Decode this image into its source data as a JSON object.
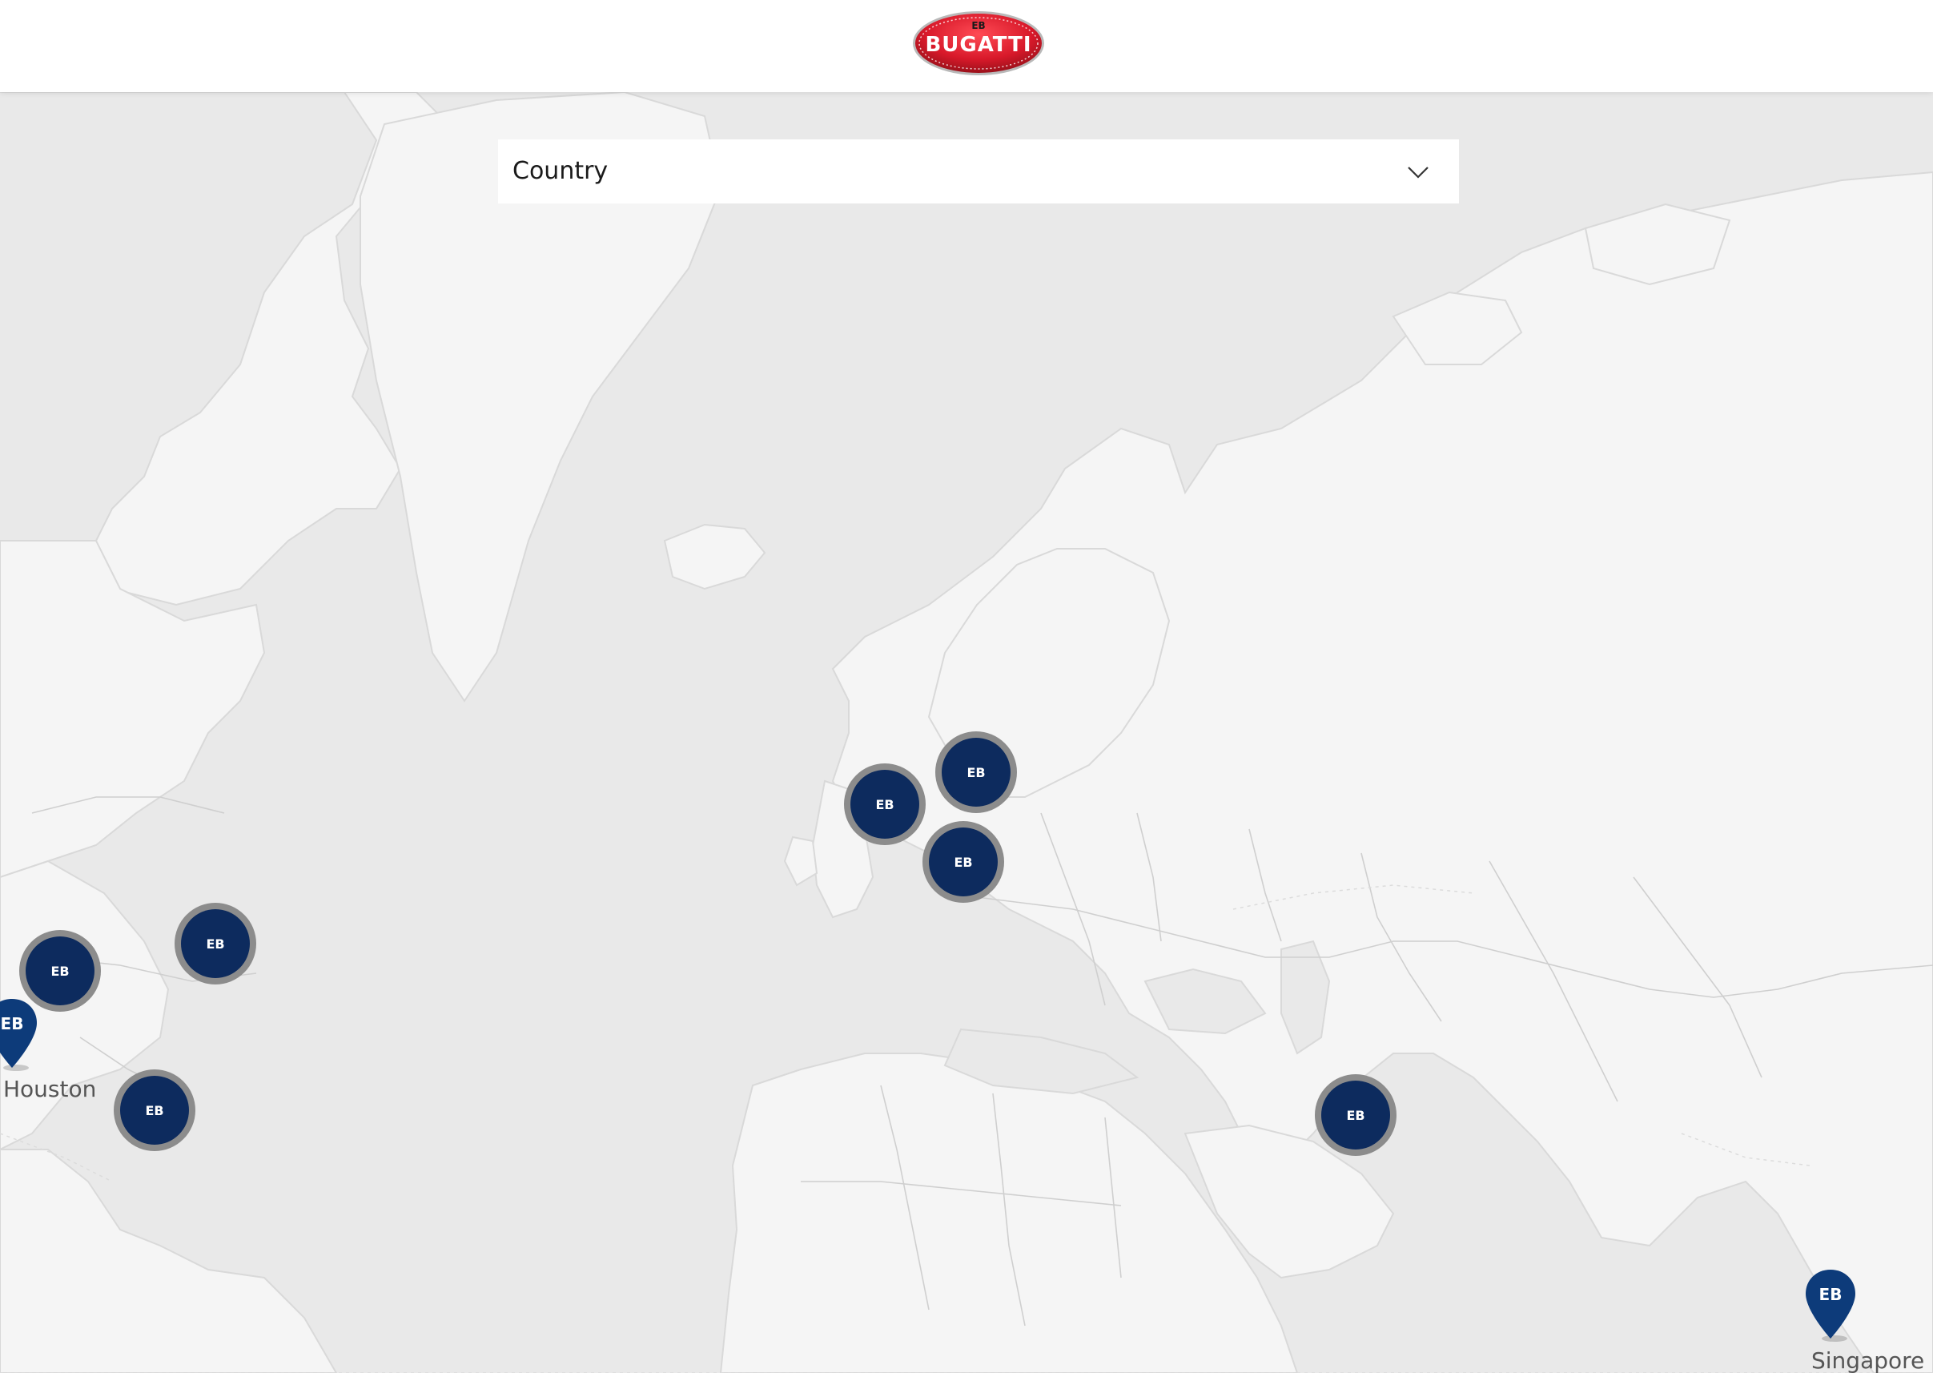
{
  "header": {
    "logo_text": "BUGATTI"
  },
  "country_select": {
    "label": "Country"
  },
  "map": {
    "clusters": [
      {
        "id": "north-america-east",
        "icon": "bugatti-eb-icon"
      },
      {
        "id": "north-america-central",
        "icon": "bugatti-eb-icon"
      },
      {
        "id": "caribbean",
        "icon": "bugatti-eb-icon"
      },
      {
        "id": "uk",
        "icon": "bugatti-eb-icon"
      },
      {
        "id": "benelux",
        "icon": "bugatti-eb-icon"
      },
      {
        "id": "central-europe",
        "icon": "bugatti-eb-icon"
      },
      {
        "id": "middle-east",
        "icon": "bugatti-eb-icon"
      }
    ],
    "pins": [
      {
        "label": "Houston",
        "icon": "bugatti-eb-icon"
      },
      {
        "label": "Singapore",
        "icon": "bugatti-eb-icon"
      }
    ],
    "colors": {
      "water": "#e8e8e8",
      "land": "#f5f5f5",
      "border": "#cfcfcf",
      "marker": "#0d2b5e",
      "marker_ring": "#8c8c8c",
      "pin": "#0d3b7a"
    }
  }
}
